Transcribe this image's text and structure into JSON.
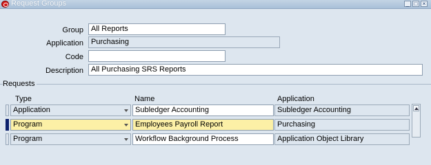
{
  "window": {
    "title": "Request Groups"
  },
  "header": {
    "group_label": "Group",
    "group_value": "All Reports",
    "application_label": "Application",
    "application_value": "Purchasing",
    "code_label": "Code",
    "code_value": "",
    "description_label": "Description",
    "description_value": "All Purchasing SRS Reports"
  },
  "requests": {
    "section_label": "Requests",
    "columns": [
      "Type",
      "Name",
      "Application"
    ],
    "rows": [
      {
        "type": "Application",
        "name": "Subledger Accounting",
        "application": "Subledger Accounting"
      },
      {
        "type": "Program",
        "name": "Employees Payroll Report",
        "application": "Purchasing"
      },
      {
        "type": "Program",
        "name": "Workflow Background Process",
        "application": "Application Object Library"
      }
    ]
  },
  "icons": {
    "minimize": "minimize-icon",
    "maximize": "maximize-icon",
    "close": "close-icon"
  },
  "colors": {
    "current_row": "#fcf0a6",
    "indicator": "#0a1f6b"
  }
}
